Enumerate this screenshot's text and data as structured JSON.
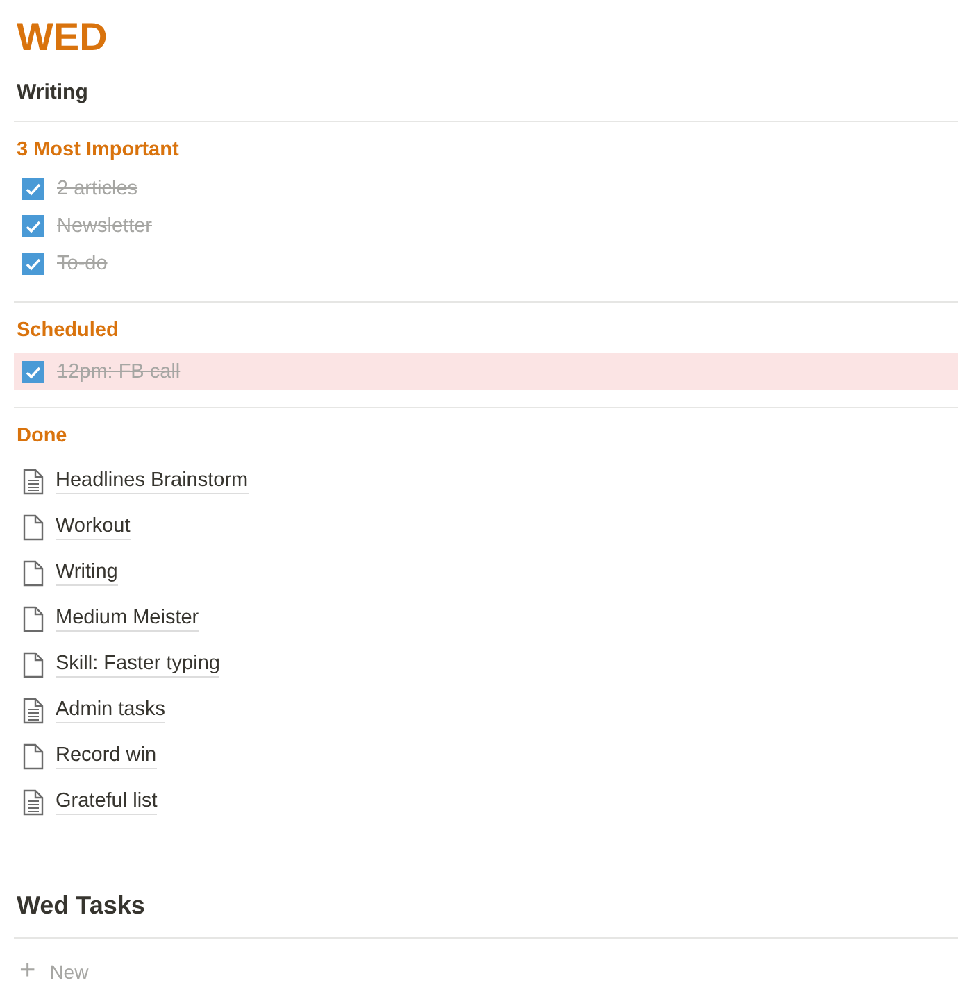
{
  "title": "WED",
  "subtitle": "Writing",
  "sections": [
    {
      "heading": "3 Most Important",
      "todos": [
        {
          "text": "2 articles",
          "checked": true,
          "highlighted": false
        },
        {
          "text": "Newsletter",
          "checked": true,
          "highlighted": false
        },
        {
          "text": "To-do",
          "checked": true,
          "highlighted": false
        }
      ]
    },
    {
      "heading": "Scheduled",
      "todos": [
        {
          "text": "12pm: FB call",
          "checked": true,
          "highlighted": true
        }
      ]
    }
  ],
  "done": {
    "heading": "Done",
    "pages": [
      {
        "title": "Headlines Brainstorm",
        "kind": "text"
      },
      {
        "title": "Workout",
        "kind": "blank"
      },
      {
        "title": "Writing",
        "kind": "blank"
      },
      {
        "title": "Medium Meister",
        "kind": "blank"
      },
      {
        "title": "Skill: Faster typing",
        "kind": "blank"
      },
      {
        "title": "Admin tasks",
        "kind": "text"
      },
      {
        "title": "Record win",
        "kind": "blank"
      },
      {
        "title": "Grateful list",
        "kind": "text"
      }
    ]
  },
  "database": {
    "title": "Wed Tasks",
    "new_label": "New",
    "new_icon": "+"
  }
}
